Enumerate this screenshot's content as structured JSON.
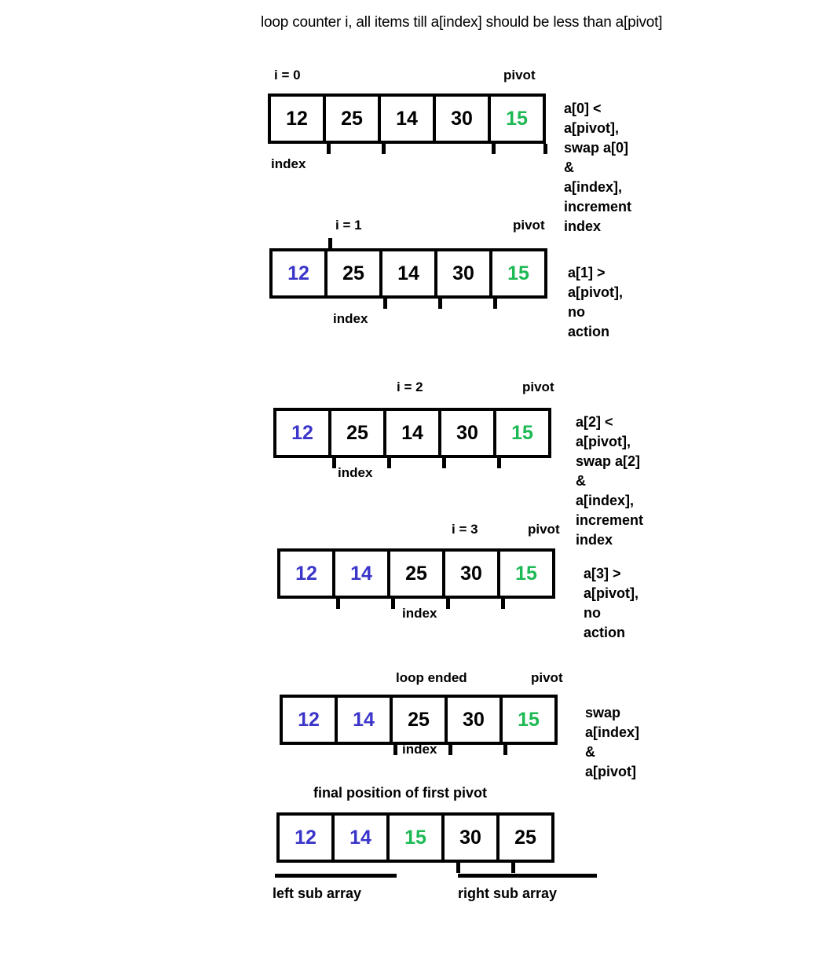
{
  "title": "loop counter i, all items till a[index] should be less than a[pivot]",
  "colors": {
    "blue": "#3b36c9",
    "green": "#1db954",
    "black": "#000000",
    "background": "#ffffff"
  },
  "labels": {
    "index": "index",
    "pivot": "pivot",
    "left_sub_array": "left sub array",
    "right_sub_array": "right sub array"
  },
  "steps": [
    {
      "id": "step-0",
      "counter_label": "i = 0",
      "pivot_label": "pivot",
      "index_label": "index",
      "cells": [
        {
          "value": "12",
          "color": "black"
        },
        {
          "value": "25",
          "color": "black"
        },
        {
          "value": "14",
          "color": "black"
        },
        {
          "value": "30",
          "color": "black"
        },
        {
          "value": "15",
          "color": "green"
        }
      ],
      "note": "a[0] < a[pivot], swap a[0] &\na[index], increment index"
    },
    {
      "id": "step-1",
      "counter_label": "i = 1",
      "pivot_label": "pivot",
      "index_label": "index",
      "cells": [
        {
          "value": "12",
          "color": "blue"
        },
        {
          "value": "25",
          "color": "black"
        },
        {
          "value": "14",
          "color": "black"
        },
        {
          "value": "30",
          "color": "black"
        },
        {
          "value": "15",
          "color": "green"
        }
      ],
      "note": "a[1] > a[pivot], no action"
    },
    {
      "id": "step-2",
      "counter_label": "i = 2",
      "pivot_label": "pivot",
      "index_label": "index",
      "cells": [
        {
          "value": "12",
          "color": "blue"
        },
        {
          "value": "25",
          "color": "black"
        },
        {
          "value": "14",
          "color": "black"
        },
        {
          "value": "30",
          "color": "black"
        },
        {
          "value": "15",
          "color": "green"
        }
      ],
      "note": "a[2] < a[pivot], swap a[2] &\na[index], increment index"
    },
    {
      "id": "step-3",
      "counter_label": "i = 3",
      "pivot_label": "pivot",
      "index_label": "index",
      "cells": [
        {
          "value": "12",
          "color": "blue"
        },
        {
          "value": "14",
          "color": "blue"
        },
        {
          "value": "25",
          "color": "black"
        },
        {
          "value": "30",
          "color": "black"
        },
        {
          "value": "15",
          "color": "green"
        }
      ],
      "note": "a[3] > a[pivot], no action"
    },
    {
      "id": "step-4",
      "counter_label": "loop ended",
      "pivot_label": "pivot",
      "index_label": "index",
      "cells": [
        {
          "value": "12",
          "color": "blue"
        },
        {
          "value": "14",
          "color": "blue"
        },
        {
          "value": "25",
          "color": "black"
        },
        {
          "value": "30",
          "color": "black"
        },
        {
          "value": "15",
          "color": "green"
        }
      ],
      "note": "swap a[index] & a[pivot]"
    },
    {
      "id": "step-5",
      "counter_label": "final position of first pivot",
      "cells": [
        {
          "value": "12",
          "color": "blue"
        },
        {
          "value": "14",
          "color": "blue"
        },
        {
          "value": "15",
          "color": "green"
        },
        {
          "value": "30",
          "color": "black"
        },
        {
          "value": "25",
          "color": "black"
        }
      ],
      "left_sub_array": "left sub array",
      "right_sub_array": "right sub array"
    }
  ]
}
